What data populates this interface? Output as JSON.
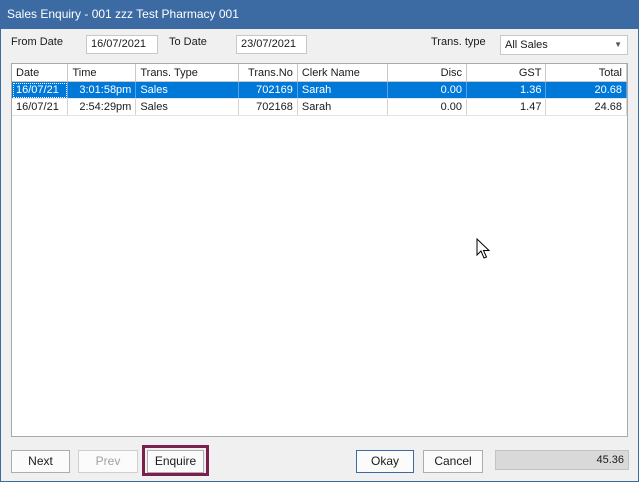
{
  "window": {
    "title": "Sales Enquiry - 001 zzz Test Pharmacy  001"
  },
  "filters": {
    "from_date_label": "From Date",
    "from_date_value": "16/07/2021",
    "to_date_label": "To Date",
    "to_date_value": "23/07/2021",
    "trans_type_label": "Trans. type",
    "trans_type_value": "All Sales"
  },
  "grid": {
    "columns": [
      "Date",
      "Time",
      "Trans. Type",
      "Trans.No",
      "Clerk Name",
      "Disc",
      "GST",
      "Total"
    ],
    "rows": [
      [
        "16/07/21",
        "3:01:58pm",
        "Sales",
        "702169",
        "Sarah",
        "0.00",
        "1.36",
        "20.68"
      ],
      [
        "16/07/21",
        "2:54:29pm",
        "Sales",
        "702168",
        "Sarah",
        "0.00",
        "1.47",
        "24.68"
      ]
    ],
    "selected_row": 0
  },
  "buttons": {
    "next": "Next",
    "prev": "Prev",
    "enquire": "Enquire",
    "okay": "Okay",
    "cancel": "Cancel"
  },
  "status": {
    "total": "45.36"
  },
  "colors": {
    "titlebar": "#3c6aa3",
    "selection": "#0078d7",
    "highlight_border": "#7b1f4e"
  },
  "icons": {
    "dropdown": "chevron-down-icon",
    "cursor": "mouse-pointer-icon"
  }
}
